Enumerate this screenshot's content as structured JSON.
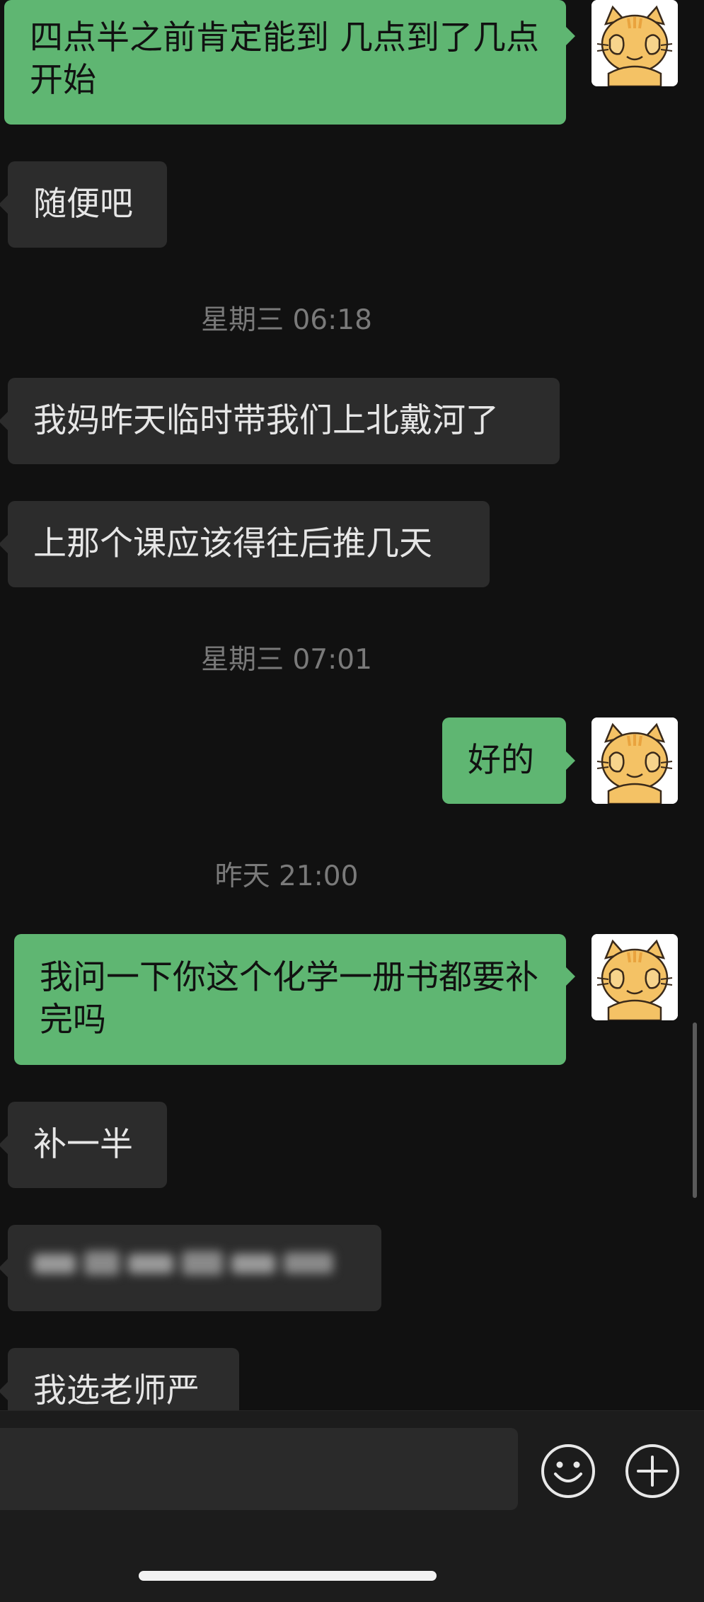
{
  "messages": [
    {
      "side": "out",
      "text": "四点半之前肯定能到 几点到了几点开始"
    },
    {
      "side": "in",
      "text": "随便吧"
    },
    {
      "type": "time",
      "text": "星期三 06:18"
    },
    {
      "side": "in",
      "text": "我妈昨天临时带我们上北戴河了"
    },
    {
      "side": "in",
      "text": "上那个课应该得往后推几天"
    },
    {
      "type": "time",
      "text": "星期三 07:01"
    },
    {
      "side": "out",
      "text": "好的"
    },
    {
      "type": "time",
      "text": "昨天 21:00"
    },
    {
      "side": "out",
      "text": "我问一下你这个化学一册书都要补完吗"
    },
    {
      "side": "in",
      "text": "补一半"
    },
    {
      "side": "in",
      "text": "",
      "blurred": true
    },
    {
      "side": "in",
      "text": "我选老师严"
    }
  ],
  "avatar": {
    "icon": "orange-cat-covering-face",
    "colors": {
      "fur": "#f4c265",
      "stripe": "#e9a33e",
      "line": "#3a2a1a"
    }
  },
  "input_bar": {
    "emoji_icon": "smiley-face-icon",
    "plus_icon": "plus-circle-icon"
  },
  "colors": {
    "background": "#111111",
    "incoming_bubble": "#2c2c2c",
    "outgoing_bubble": "#5fb672",
    "timestamp": "#7a7a7a"
  }
}
